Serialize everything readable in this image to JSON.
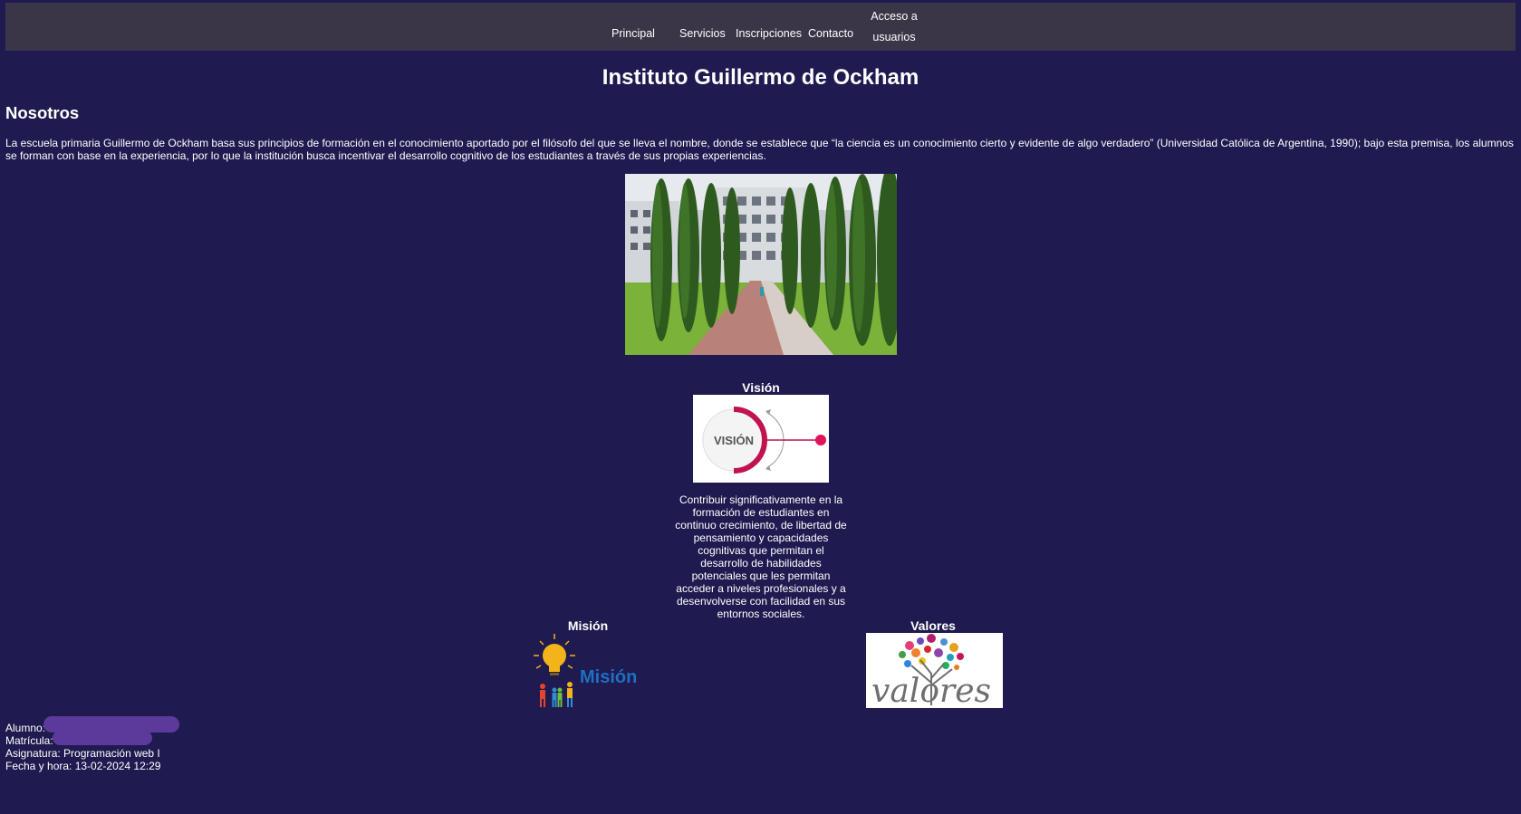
{
  "navbar": {
    "items": [
      {
        "label": "Principal"
      },
      {
        "label": "Servicios"
      },
      {
        "label": "Inscripciones"
      },
      {
        "label": "Contacto"
      },
      {
        "label": "Acceso a usuarios"
      }
    ]
  },
  "header": {
    "title": "Instituto Guillermo de Ockham"
  },
  "about": {
    "heading": "Nosotros",
    "text": "La escuela primaria Guillermo de Ockham basa sus principios de formación en el conocimiento aportado por el filósofo del que se lleva el nombre, donde se establece que “la ciencia es un conocimiento cierto y evidente de algo verdadero” (Universidad Católica de Argentina, 1990); bajo esta premisa, los alumnos se forman con base en la experiencia, por lo que la institución busca incentivar el desarrollo cognitivo de los estudiantes a través de sus propias experiencias."
  },
  "vision": {
    "heading": "Visión",
    "image_text": "VISIÓN",
    "text": "Contribuir significativamente en la formación de estudiantes en continuo crecimiento, de libertad de pensamiento y capacidades cognitivas que permitan el desarrollo de habilidades potenciales que les permitan acceder a niveles profesionales y a desenvolverse con facilidad en sus entornos sociales."
  },
  "mision": {
    "heading": "Misión",
    "image_text": "Misión"
  },
  "valores": {
    "heading": "Valores",
    "image_text": "valores"
  },
  "footer": {
    "alumno_label": "Alumno:",
    "matricula_label": "Matrícula:",
    "asignatura": "Asignatura: Programación web I",
    "fecha": "Fecha y hora: 13-02-2024 12:29"
  },
  "colors": {
    "background": "#1f1a4f",
    "navbar": "#3a3647",
    "vision_accent": "#c0134f",
    "mision_text": "#1f6fc2",
    "redaction": "#5b3a9c"
  }
}
